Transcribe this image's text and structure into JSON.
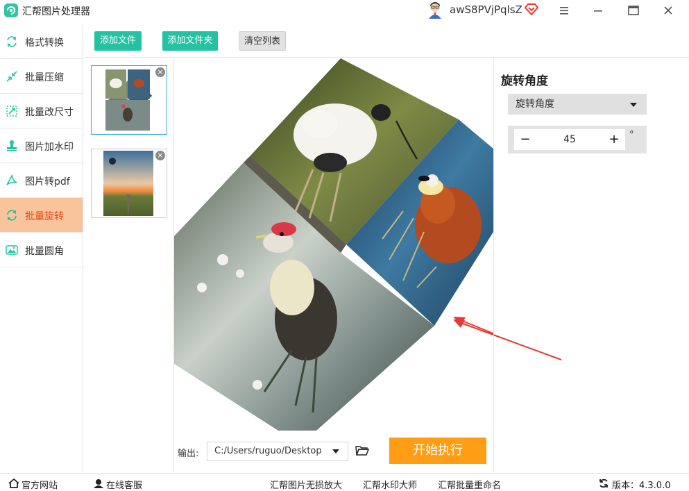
{
  "app": {
    "title": "汇帮图片处理器"
  },
  "user": {
    "name": "awS8PVjPqlsZ"
  },
  "sidebar": {
    "items": [
      {
        "label": "格式转换"
      },
      {
        "label": "批量压缩"
      },
      {
        "label": "批量改尺寸"
      },
      {
        "label": "图片加水印"
      },
      {
        "label": "图片转pdf"
      },
      {
        "label": "批量旋转",
        "active": true
      },
      {
        "label": "批量圆角"
      }
    ]
  },
  "toolbar": {
    "add_file": "添加文件",
    "add_folder": "添加文件夹",
    "clear_list": "清空列表"
  },
  "rotate": {
    "title": "旋转角度",
    "mode": "旋转角度",
    "value": "45",
    "unit": "°",
    "minus": "−",
    "plus": "+"
  },
  "output": {
    "label": "输出:",
    "path": "C:/Users/ruguo/Desktop"
  },
  "start_label": "开始执行",
  "footer": {
    "official_site": "官方网站",
    "support": "在线客服",
    "link1": "汇帮图片无损放大",
    "link2": "汇帮水印大师",
    "link3": "汇帮批量重命名",
    "version": "版本：4.3.0.0"
  },
  "colors": {
    "accent_green": "#22c2a2",
    "active_tab_bg": "#f9c49c",
    "active_tab_text": "#e64a19",
    "start_button": "#ff9d14",
    "arrow": "#e53935"
  }
}
